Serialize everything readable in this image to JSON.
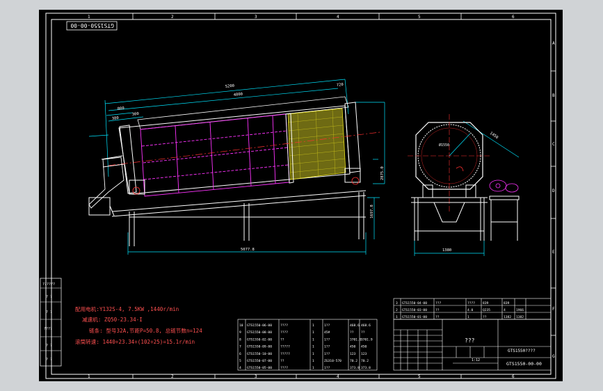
{
  "title_block": {
    "drawing_no_rotated": "GTS1550-00-00",
    "name": "???",
    "part_title": "GTS1550????",
    "drawing_no": "GTS1550-00-00",
    "scale": "1:12"
  },
  "grid": {
    "columns": [
      "1",
      "2",
      "3",
      "4",
      "5",
      "6"
    ],
    "rows_right": [
      "A",
      "B",
      "C",
      "D",
      "E",
      "F",
      "G",
      "H"
    ]
  },
  "dims": {
    "overall_len": "5200",
    "drum_len": "4800",
    "d1": "800",
    "d2": "300",
    "d3": "380",
    "d4": "720",
    "base_len": "5077.8",
    "height_right": "2875.0",
    "frame_h": "1697.8",
    "side_w": "1380",
    "diag": "1450",
    "inner_d": "Ø1550"
  },
  "side_labels": [
    "??????",
    "? ?",
    "? ?",
    "????",
    "? ?",
    "? ?"
  ],
  "notes": {
    "motor": "配用电机:Y132S-4, 7.5KW ,1440r/min",
    "reducer": "减速机: ZQ50-23.34-I",
    "chain": "链条: 型号32A,节距P=50.8, 总链节数n=124",
    "speed": "滚筒转速: 1440÷23.34÷(102÷25)=15.1r/min"
  },
  "parts_upper": [
    [
      "3",
      "GTS1550-04-00",
      "???",
      "",
      "????",
      "839",
      "839"
    ],
    [
      "2",
      "GTS1550-03-00",
      "??",
      "",
      "4.0",
      "Q235",
      "4",
      "1966"
    ],
    [
      "1",
      "GTS1550-01-00",
      "??",
      "",
      "1",
      "??",
      "1382",
      "1382"
    ]
  ],
  "parts_lower": [
    [
      "10",
      "GTS1550-06-00",
      "????",
      "1",
      "1??",
      "468.6",
      "468.6"
    ],
    [
      "9",
      "GTS1550-08-00",
      "????",
      "1",
      "45#",
      "??",
      "??"
    ],
    [
      "8",
      "GTS1550-02-00",
      "??",
      "1",
      "1??",
      "3701.9",
      "3701.9"
    ],
    [
      "7",
      "GTS1550-09-00",
      "?????",
      "1",
      "1??",
      "450",
      "450"
    ],
    [
      "6",
      "GTS1550-10-00",
      "?????",
      "1",
      "1??",
      "123",
      "123"
    ],
    [
      "5",
      "GTS1550-07-00",
      "??",
      "1",
      "ZG310-570",
      "70.2",
      "70.2"
    ],
    [
      "4",
      "GTS1550-05-00",
      "????",
      "1",
      "1??",
      "373.8",
      "373.8"
    ]
  ]
}
